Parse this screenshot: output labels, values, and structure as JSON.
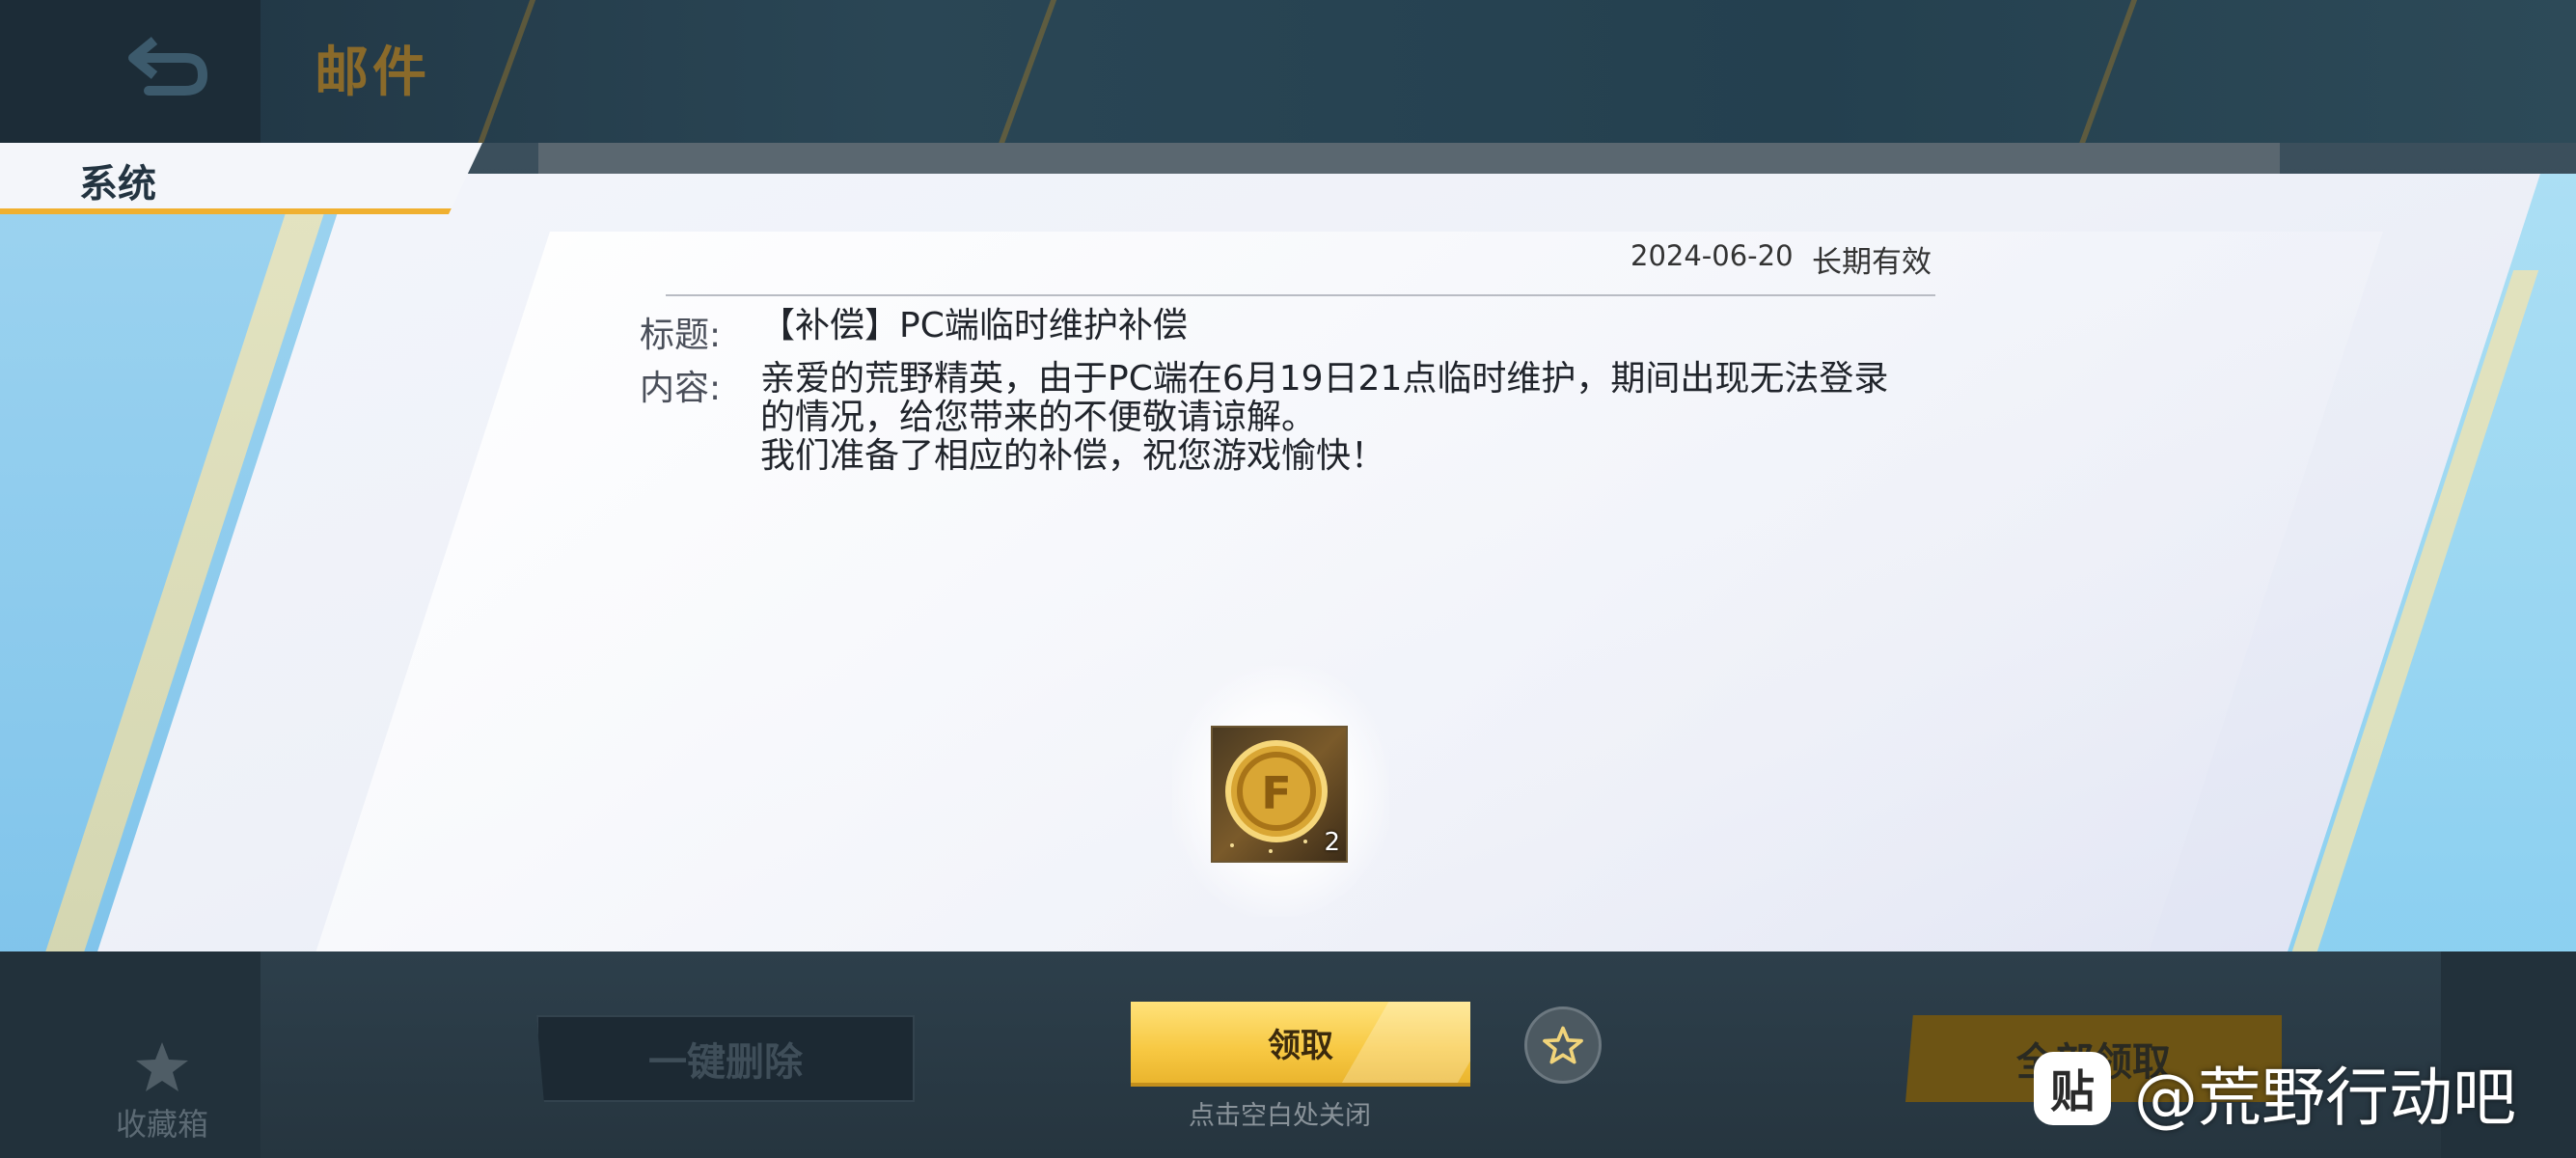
{
  "header": {
    "title": "邮件"
  },
  "tab": {
    "label": "系统"
  },
  "mail": {
    "date": "2024-06-20",
    "validity": "长期有效",
    "title_label": "标题:",
    "title_value": "【补偿】PC端临时维护补偿",
    "content_label": "内容:",
    "content_lines": [
      "亲爱的荒野精英，由于PC端在6月19日21点临时维护，期间出现无法登录",
      "的情况，给您带来的不便敬请谅解。",
      "我们准备了相应的补偿，祝您游戏愉快！"
    ]
  },
  "reward": {
    "count": "2",
    "icon": "gold-coin-icon"
  },
  "footer": {
    "favorites_label": "收藏箱",
    "delete_all_label": "一键删除",
    "claim_label": "领取",
    "close_hint": "点击空白处关闭",
    "claim_all_label": "全部领取"
  },
  "watermark": {
    "logo": "贴",
    "text": "@荒野行动吧"
  },
  "colors": {
    "accent": "#f7c842",
    "header": "#24404f",
    "sheet": "#eef1f8"
  }
}
